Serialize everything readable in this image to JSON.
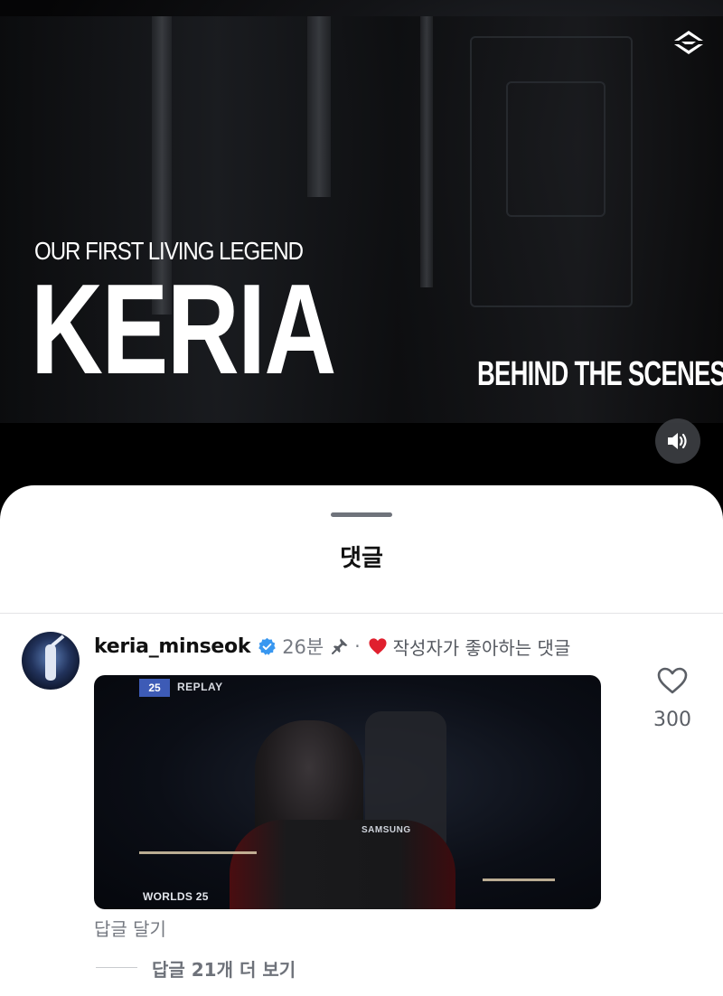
{
  "video": {
    "kicker": "OUR FIRST LIVING LEGEND",
    "title": "KERIA",
    "tagline": "BEHIND THE SCENES",
    "sound_icon": "speaker-on-icon",
    "logo_icon": "brand-logo-icon"
  },
  "comments_sheet": {
    "title": "댓글"
  },
  "comment": {
    "username": "keria_minseok",
    "verified_icon": "verified-badge-icon",
    "time": "26분",
    "pin_icon": "pin-icon",
    "separator": "·",
    "liked_by_author": "작성자가 좋아하는 댓글",
    "media": {
      "badge": "25",
      "overlay_label": "REPLAY",
      "event_label": "WORLDS 25",
      "sponsor_text": "SAMSUNG"
    },
    "like_count": "300",
    "reply_label": "답글 달기",
    "view_more_replies": "답글 21개 더 보기"
  },
  "colors": {
    "verified_blue": "#3897f0",
    "heart_red": "#e0202e",
    "text_primary": "#111111",
    "text_secondary": "#767a82"
  }
}
